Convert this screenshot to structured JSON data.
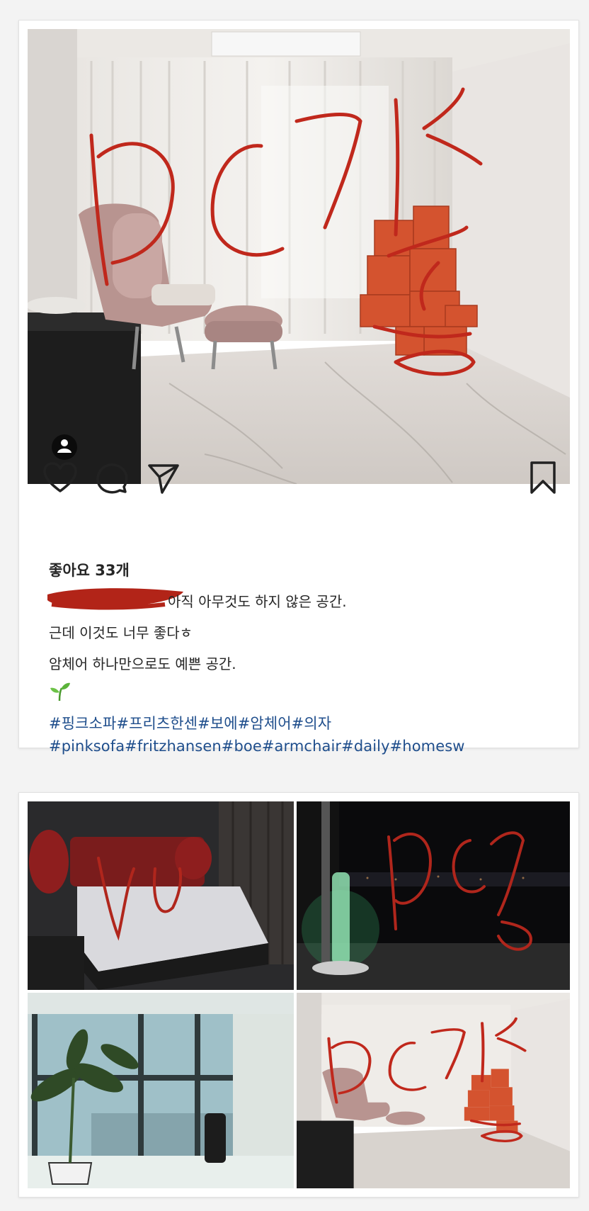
{
  "post": {
    "likes_label": "좋아요 33개",
    "caption_lines": [
      "아직 아무것도 하지 않은 공간.",
      "근데 이것도 너무 좋다ㅎ",
      "암체어 하나만으로도 예쁜 공간."
    ],
    "hashtags_line1": "#핑크소파#프리츠한센#보에#암체어#의자",
    "hashtags_line2": "#pinksofa#fritzhansen#boe#armchair#daily#homesw",
    "icons": [
      "heart-icon",
      "comment-icon",
      "share-icon",
      "bookmark-icon",
      "user-tag-icon",
      "seedling-icon"
    ]
  },
  "colors": {
    "link": "#1f4e8c",
    "scribble": "#c0281c",
    "redaction": "#b22418"
  }
}
